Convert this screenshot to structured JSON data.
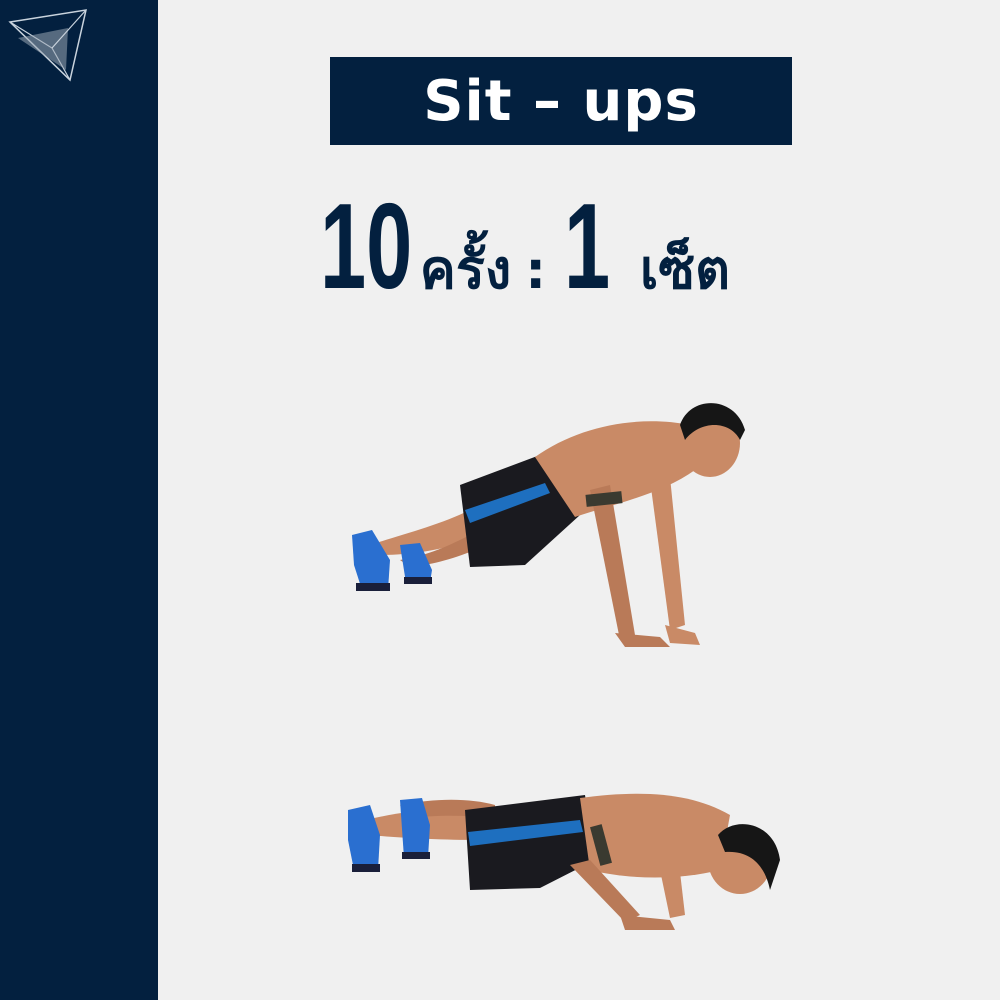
{
  "title": "Sit – ups",
  "reps": {
    "count": "10",
    "count_unit": "ครั้ง",
    "separator": ":",
    "sets": "1",
    "sets_unit": "เซ็ต"
  },
  "icons": {
    "logo": "triangle-logo-icon"
  },
  "colors": {
    "navy": "#03203f",
    "background": "#f0f0f0",
    "title_text": "#ffffff",
    "shorts_accent": "#1e6fbf"
  }
}
